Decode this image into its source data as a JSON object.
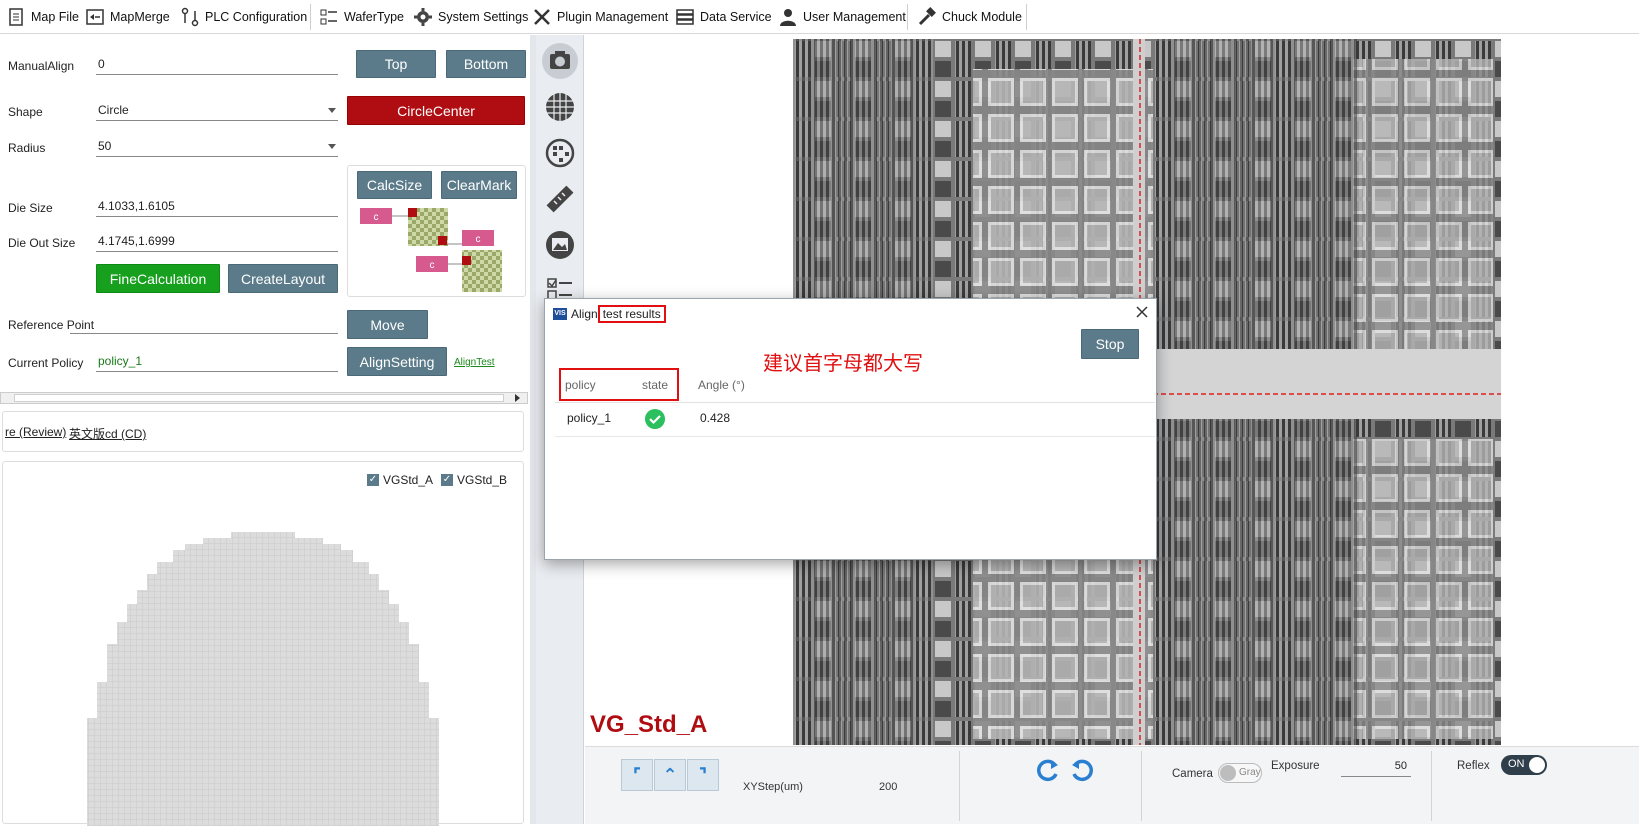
{
  "toolbar": {
    "items": [
      {
        "label": "Map File",
        "icon": "document-icon"
      },
      {
        "label": "MapMerge",
        "icon": "map-merge-icon"
      },
      {
        "label": "PLC Configuration",
        "icon": "plc-icon"
      },
      {
        "label": "WaferType",
        "icon": "list-icon"
      },
      {
        "label": "System Settings",
        "icon": "gear-icon"
      },
      {
        "label": "Plugin Management",
        "icon": "tools-icon"
      },
      {
        "label": "Data Service",
        "icon": "database-icon"
      },
      {
        "label": "User Management",
        "icon": "user-icon"
      },
      {
        "label": "Chuck Module",
        "icon": "hammer-icon"
      }
    ]
  },
  "left": {
    "manual_align": {
      "label": "ManualAlign",
      "value": "0"
    },
    "top_button": "Top",
    "bottom_button": "Bottom",
    "shape": {
      "label": "Shape",
      "value": "Circle"
    },
    "circle_center_button": "CircleCenter",
    "radius": {
      "label": "Radius",
      "value": "50"
    },
    "calc_size_button": "CalcSize",
    "clear_mark_button": "ClearMark",
    "die_size": {
      "label": "Die Size",
      "value": "4.1033,1.6105"
    },
    "die_out_size": {
      "label": "Die Out Size",
      "value": "4.1745,1.6999"
    },
    "fine_calc_button": "FineCalculation",
    "create_layout_button": "CreateLayout",
    "reference_point": {
      "label": "Reference Point",
      "value": ""
    },
    "move_button": "Move",
    "current_policy": {
      "label": "Current Policy",
      "value": "policy_1"
    },
    "align_setting_button": "AlignSetting",
    "align_test_link": "AlignTest",
    "diagram_marker": "c",
    "tabs": [
      "re (Review)",
      "英文版cd (CD)"
    ],
    "checkboxes": [
      {
        "label": "VGStd_A",
        "checked": true
      },
      {
        "label": "VGStd_B",
        "checked": true
      }
    ]
  },
  "image": {
    "overlay_label": "VG_Std_A",
    "overlay_color": "#b00d12"
  },
  "bottom": {
    "xystep_label": "XYStep(um)",
    "xystep_value": "200",
    "camera_label": "Camera",
    "camera_toggle": "Gray",
    "exposure_label": "Exposure",
    "exposure_value": "50",
    "reflex_label": "Reflex",
    "reflex_toggle": "ON"
  },
  "dialog": {
    "title_prefix": "Align",
    "title_highlight": "test results",
    "stop_button": "Stop",
    "annotation": "建议首字母都大写",
    "annotation_color": "#e01010",
    "columns": [
      "policy",
      "state",
      "Angle (°)"
    ],
    "rows": [
      {
        "policy": "policy_1",
        "state": "success",
        "angle": "0.428"
      }
    ]
  }
}
